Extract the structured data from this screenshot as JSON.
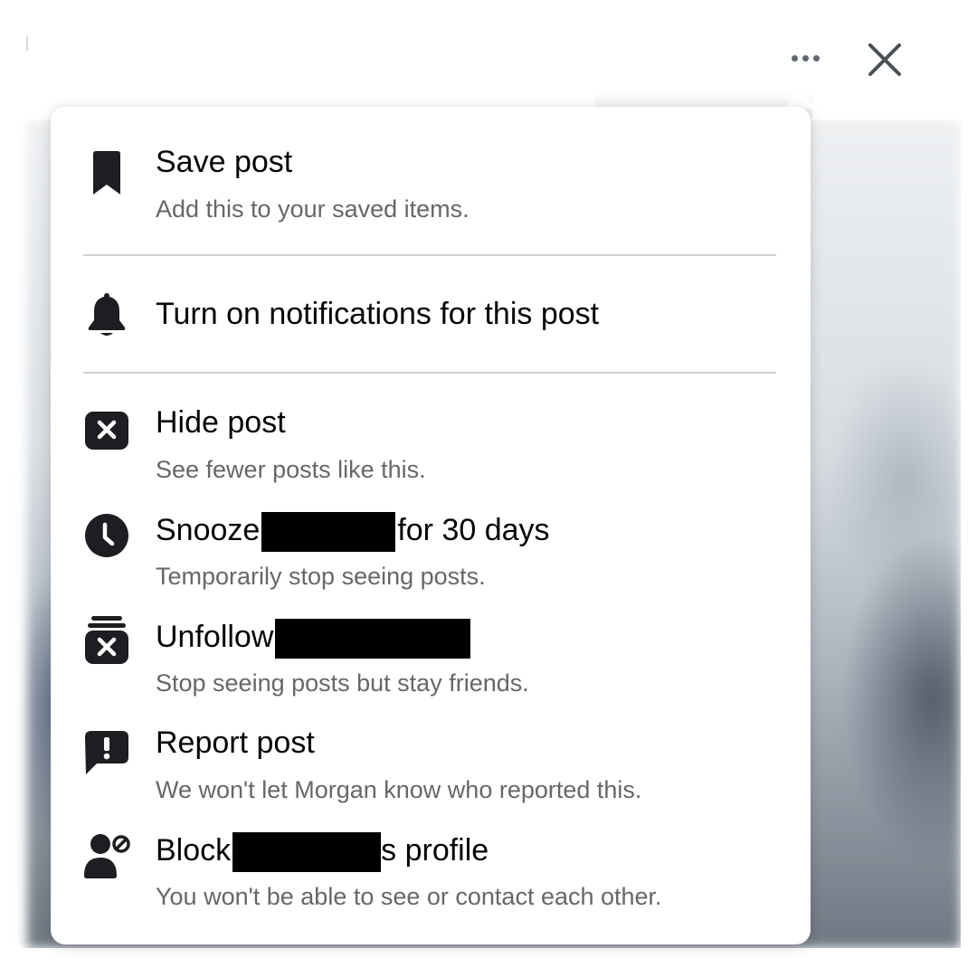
{
  "header": {
    "more_icon": "more-horizontal-icon",
    "close_icon": "close-icon"
  },
  "menu": {
    "items": [
      {
        "id": "save",
        "icon": "bookmark-icon",
        "title": "Save post",
        "subtitle": "Add this to your saved items."
      },
      {
        "id": "notifications",
        "icon": "bell-icon",
        "title": "Turn on notifications for this post",
        "subtitle": ""
      },
      {
        "id": "hide",
        "icon": "hide-x-icon",
        "title": "Hide post",
        "subtitle": "See fewer posts like this."
      },
      {
        "id": "snooze",
        "icon": "clock-icon",
        "title_before": "Snooze",
        "title_after": "for 30 days",
        "subtitle": "Temporarily stop seeing posts."
      },
      {
        "id": "unfollow",
        "icon": "unfollow-icon",
        "title_before": "Unfollow",
        "title_after": "",
        "subtitle": "Stop seeing posts but stay friends."
      },
      {
        "id": "report",
        "icon": "report-icon",
        "title": "Report post",
        "subtitle": "We won't let Morgan know who reported this."
      },
      {
        "id": "block",
        "icon": "block-user-icon",
        "title_before": "Block",
        "title_after": "s profile",
        "subtitle": "You won't be able to see or contact each other."
      }
    ]
  },
  "colors": {
    "text_primary": "#050505",
    "text_secondary": "#65676b",
    "icon": "#1c1e21",
    "divider": "#ced0d4",
    "redaction": "#000000"
  }
}
